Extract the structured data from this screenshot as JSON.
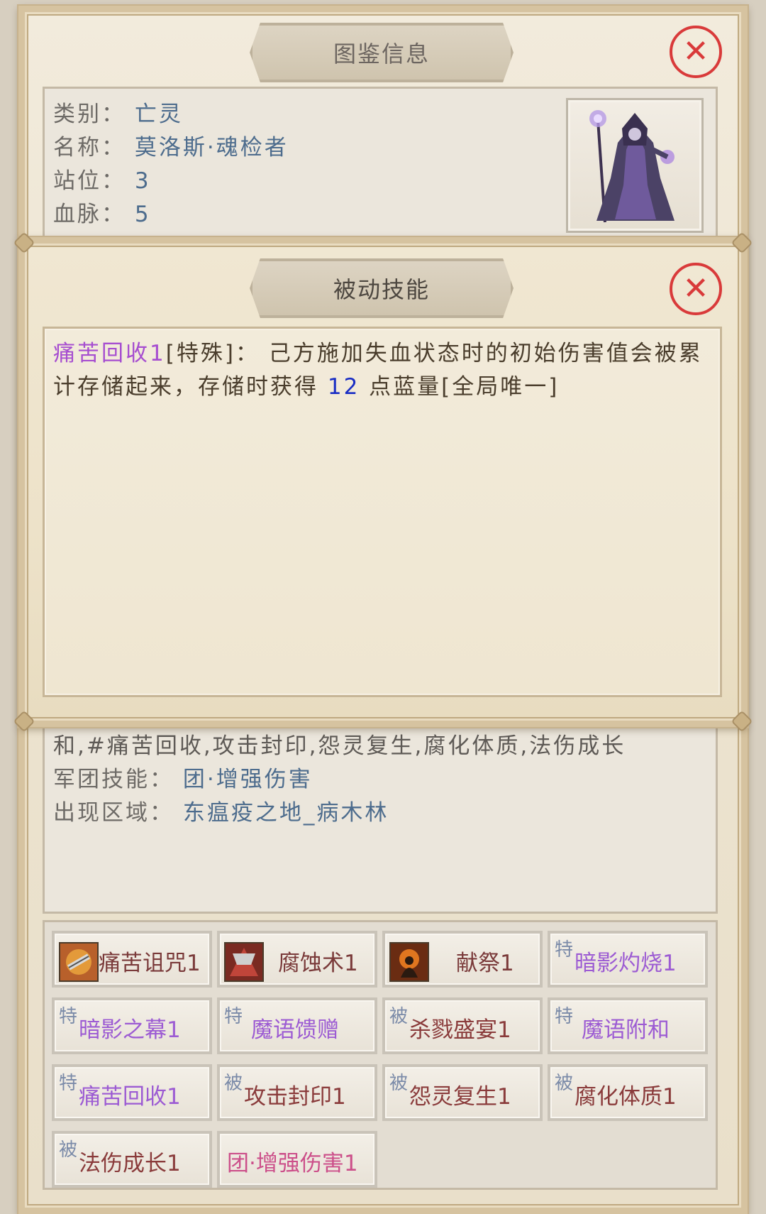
{
  "info_panel": {
    "title": "图鉴信息",
    "category_label": "类别：",
    "category_value": "亡灵",
    "name_label": "名称：",
    "name_value": "莫洛斯·魂检者",
    "position_label": "站位：",
    "position_value": "3",
    "bloodline_label": "血脉：",
    "bloodline_value": "5",
    "skills_list_text": "和,#痛苦回收,攻击封印,怨灵复生,腐化体质,法伤成长",
    "legion_label": "军团技能：",
    "legion_value": "团·增强伤害",
    "area_label": "出现区域：",
    "area_value": "东瘟疫之地_病木林"
  },
  "passive_dialog": {
    "title": "被动技能",
    "skill_name": "痛苦回收1",
    "skill_type": "[特殊]：",
    "desc_part1": "己方施加失血状态时的初始伤害值会被累计存储起来，存储时获得",
    "mana_value": "12",
    "desc_part2": "点蓝量[全局唯一]"
  },
  "skills": [
    {
      "label": "痛苦诅咒1",
      "tag": "",
      "icon": "curse-icon"
    },
    {
      "label": "腐蚀术1",
      "tag": "",
      "icon": "corruption-icon"
    },
    {
      "label": "献祭1",
      "tag": "",
      "icon": "sacrifice-icon"
    },
    {
      "label": "暗影灼烧1",
      "tag": "特"
    },
    {
      "label": "暗影之幕1",
      "tag": "特"
    },
    {
      "label": "魔语馈赠",
      "tag": "特"
    },
    {
      "label": "杀戮盛宴1",
      "tag": "被"
    },
    {
      "label": "魔语附和",
      "tag": "特"
    },
    {
      "label": "痛苦回收1",
      "tag": "特"
    },
    {
      "label": "攻击封印1",
      "tag": "被"
    },
    {
      "label": "怨灵复生1",
      "tag": "被"
    },
    {
      "label": "腐化体质1",
      "tag": "被"
    },
    {
      "label": "法伤成长1",
      "tag": "被"
    },
    {
      "label": "团·增强伤害1",
      "tag": ""
    }
  ],
  "icons": {
    "close": "close-icon",
    "portrait": "lich-portrait"
  },
  "colors": {
    "close": "#d93a3a",
    "special_skill": "#9c5bd3",
    "passive_skill": "#8a3b3b",
    "legion_skill": "#cc4f8a",
    "value_blue": "#4d6c8d",
    "mana_blue": "#1a2ec4"
  }
}
